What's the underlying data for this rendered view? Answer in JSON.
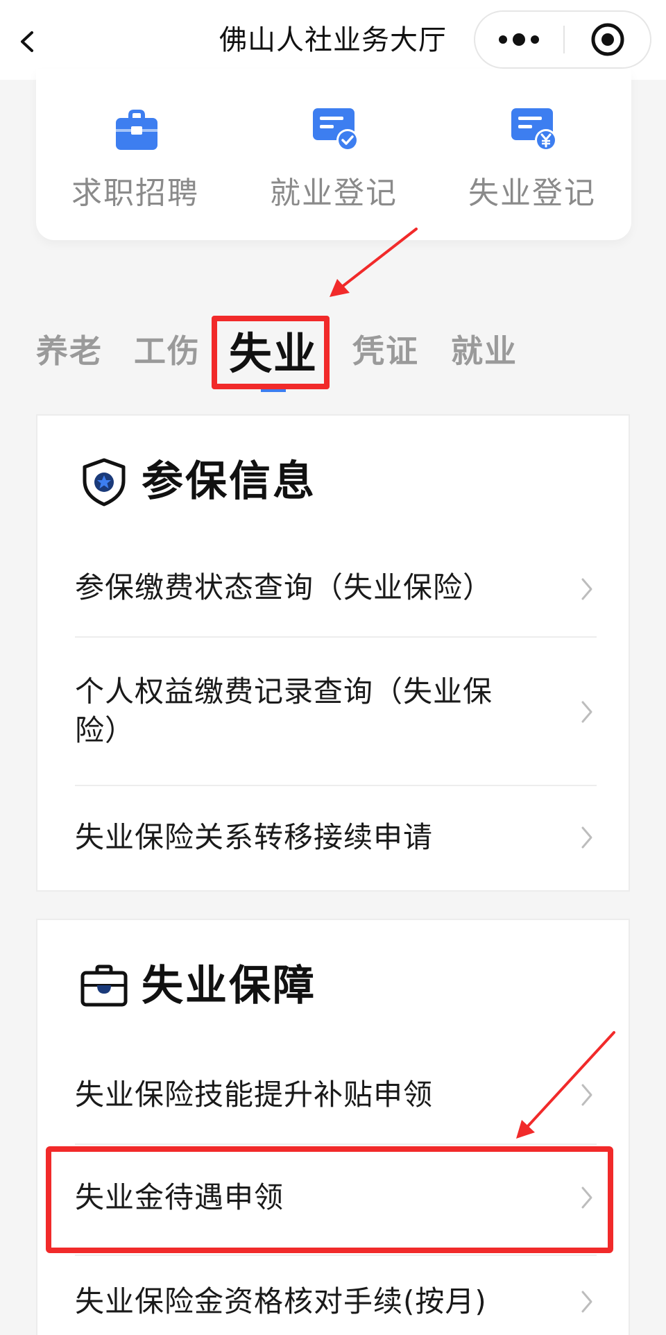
{
  "navbar": {
    "title": "佛山人社业务大厅",
    "back_icon": "chevron-left-icon",
    "more_icon": "more-dots-icon",
    "close_icon": "target-circle-icon"
  },
  "quick_actions": [
    {
      "label": "求职招聘",
      "icon": "briefcase-icon"
    },
    {
      "label": "就业登记",
      "icon": "card-check-icon"
    },
    {
      "label": "失业登记",
      "icon": "card-yuan-icon"
    }
  ],
  "tabs": [
    {
      "label": "养老",
      "active": false
    },
    {
      "label": "工伤",
      "active": false
    },
    {
      "label": "失业",
      "active": true
    },
    {
      "label": "凭证",
      "active": false
    },
    {
      "label": "就业",
      "active": false
    }
  ],
  "sections": [
    {
      "title": "参保信息",
      "icon": "shield-star-icon",
      "items": [
        "参保缴费状态查询（失业保险）",
        "个人权益缴费记录查询（失业保险）",
        "失业保险关系转移接续申请"
      ]
    },
    {
      "title": "失业保障",
      "icon": "briefcase-outline-icon",
      "items": [
        "失业保险技能提升补贴申领",
        "失业金待遇申领",
        "失业保险金资格核对手续(按月)"
      ]
    }
  ],
  "colors": {
    "accent_blue": "#3d7ef0",
    "annotation_red": "#f12a2a",
    "muted_text": "#8a8a8a"
  }
}
